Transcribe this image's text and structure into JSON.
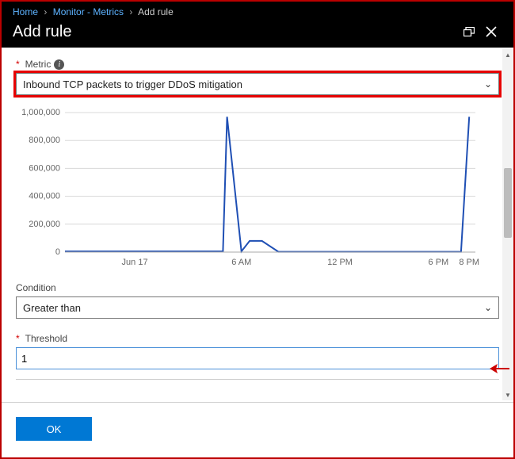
{
  "breadcrumb": {
    "items": [
      {
        "label": "Home",
        "link": true
      },
      {
        "label": "Monitor - Metrics",
        "link": true
      },
      {
        "label": "Add rule",
        "link": false
      }
    ]
  },
  "title": "Add rule",
  "fields": {
    "metric": {
      "label": "Metric",
      "required": true,
      "info": true,
      "value": "Inbound TCP packets to trigger DDoS mitigation"
    },
    "condition": {
      "label": "Condition",
      "required": false,
      "value": "Greater than"
    },
    "threshold": {
      "label": "Threshold",
      "required": true,
      "value": "1"
    }
  },
  "buttons": {
    "ok": "OK"
  },
  "chart_data": {
    "type": "line",
    "ylabel": "",
    "xlabel": "",
    "ylim": [
      0,
      1000000
    ],
    "y_ticks": [
      0,
      200000,
      400000,
      600000,
      800000,
      1000000
    ],
    "y_tick_labels": [
      "0",
      "200,000",
      "400,000",
      "600,000",
      "800,000",
      "1,000,000"
    ],
    "x_tick_labels": [
      "Jun 17",
      "6 AM",
      "12 PM",
      "6 PM",
      "8 PM"
    ],
    "x_tick_positions": [
      0.17,
      0.43,
      0.67,
      0.91,
      0.985
    ],
    "series": [
      {
        "name": "Inbound TCP packets",
        "color": "#1f4fb4",
        "points": [
          [
            0.0,
            5000
          ],
          [
            0.05,
            5000
          ],
          [
            0.1,
            5000
          ],
          [
            0.15,
            5000
          ],
          [
            0.17,
            5000
          ],
          [
            0.22,
            5000
          ],
          [
            0.27,
            5000
          ],
          [
            0.32,
            5000
          ],
          [
            0.36,
            5000
          ],
          [
            0.385,
            5000
          ],
          [
            0.395,
            970000
          ],
          [
            0.43,
            5000
          ],
          [
            0.45,
            80000
          ],
          [
            0.48,
            80000
          ],
          [
            0.52,
            2000
          ],
          [
            0.58,
            2000
          ],
          [
            0.64,
            2000
          ],
          [
            0.7,
            2000
          ],
          [
            0.76,
            2000
          ],
          [
            0.82,
            2000
          ],
          [
            0.88,
            2000
          ],
          [
            0.93,
            2000
          ],
          [
            0.965,
            2000
          ],
          [
            0.985,
            970000
          ]
        ]
      }
    ]
  }
}
